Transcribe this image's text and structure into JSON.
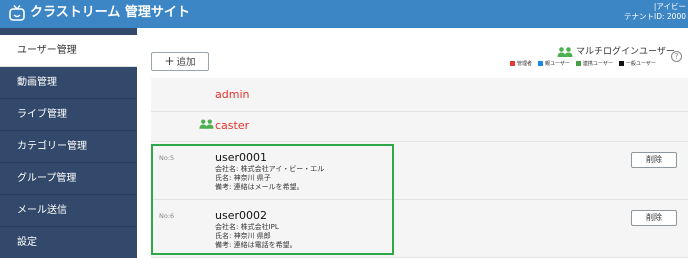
{
  "header": {
    "title": "クラストリーム 管理サイト",
    "user_name": "|アイビー",
    "tenant": "テナントID: 2000"
  },
  "sidebar": {
    "items": [
      {
        "label": "ユーザー管理",
        "active": true
      },
      {
        "label": "動画管理",
        "active": false
      },
      {
        "label": "ライブ管理",
        "active": false
      },
      {
        "label": "カテゴリー管理",
        "active": false
      },
      {
        "label": "グループ管理",
        "active": false
      },
      {
        "label": "メール送信",
        "active": false
      },
      {
        "label": "設定",
        "active": false
      }
    ]
  },
  "toolbar": {
    "add_label": "追加",
    "multi_login_label": "マルチログインユーザー",
    "help": "?"
  },
  "legend": [
    {
      "label": "管理者",
      "color": "#e53935"
    },
    {
      "label": "親ユーザー",
      "color": "#1e88e5"
    },
    {
      "label": "連携ユーザー",
      "color": "#43a047"
    },
    {
      "label": "一般ユーザー",
      "color": "#111111"
    }
  ],
  "list": {
    "admin": {
      "name": "admin"
    },
    "caster": {
      "name": "caster"
    },
    "users": [
      {
        "no": "No:5",
        "name": "user0001",
        "company": "会社名: 株式会社アイ・ビー・エル",
        "person": "氏名: 神奈川 県子",
        "note": "備考: 連絡はメールを希望。",
        "delete_label": "削除"
      },
      {
        "no": "No:6",
        "name": "user0002",
        "company": "会社名: 株式会社IPL",
        "person": "氏名: 神奈川 県郎",
        "note": "備考: 連絡は電話を希望。",
        "delete_label": "削除"
      }
    ]
  },
  "colors": {
    "header_bg": "#3d86c6",
    "sidebar_bg": "#33496b",
    "admin_text": "#e3322a",
    "group_icon": "#4caf50",
    "highlight_border": "#2ea94a"
  }
}
